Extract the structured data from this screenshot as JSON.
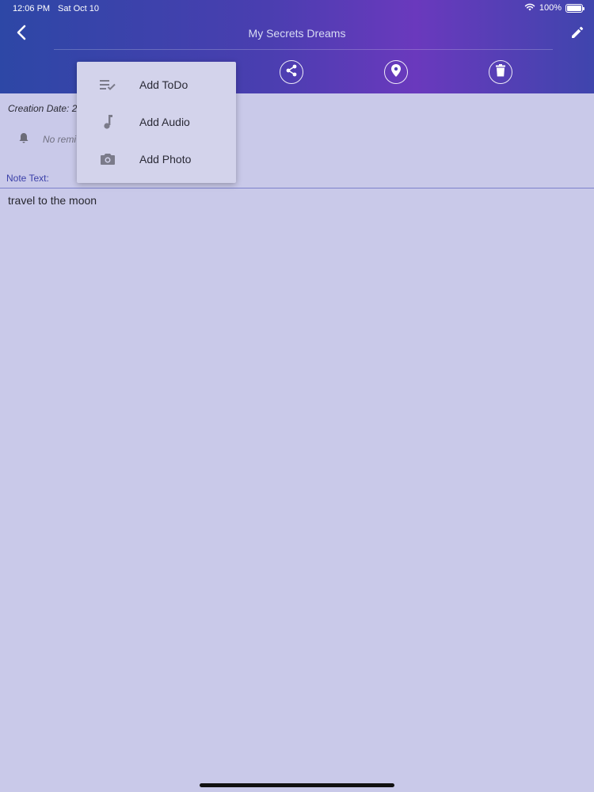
{
  "status_bar": {
    "time": "12:06 PM",
    "date": "Sat Oct 10",
    "battery": "100%",
    "icons": [
      "wifi-icon",
      "battery-icon"
    ]
  },
  "header": {
    "title": "My Secrets Dreams",
    "back_icon": "chevron-left-icon",
    "edit_icon": "pencil-icon"
  },
  "toolbar": {
    "buttons": [
      "share-icon",
      "location-pin-icon",
      "trash-icon"
    ]
  },
  "note": {
    "creation_date_label": "Creation Date: 2",
    "reminder_text": "No remi",
    "note_label": "Note Text:",
    "note_text": "travel to the moon"
  },
  "menu": {
    "items": [
      {
        "label": "Add ToDo",
        "icon": "todo-list-icon"
      },
      {
        "label": "Add Audio",
        "icon": "music-note-icon"
      },
      {
        "label": "Add Photo",
        "icon": "camera-icon"
      }
    ]
  },
  "colors": {
    "header_start": "#2d47a6",
    "header_accent": "#6a39bd",
    "background": "#c9c9e9",
    "menu_background": "#d3d3eb",
    "note_label": "#3a3fa8"
  }
}
